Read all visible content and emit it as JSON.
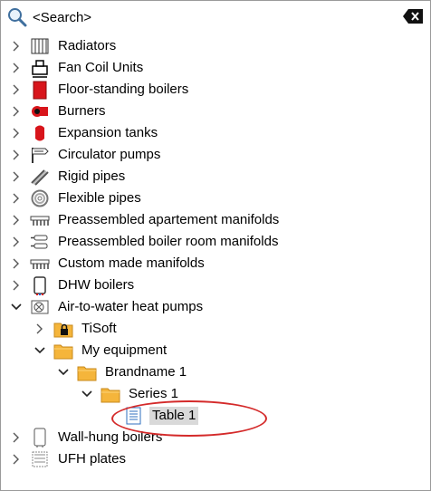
{
  "search": {
    "placeholder": "<Search>",
    "icon": "magnifier-icon",
    "clear_icon": "clear-input-icon"
  },
  "tree": {
    "items": [
      {
        "label": "Radiators",
        "icon": "radiator-icon",
        "expanded": false,
        "level": 0
      },
      {
        "label": "Fan Coil Units",
        "icon": "fan-coil-icon",
        "expanded": false,
        "level": 0
      },
      {
        "label": "Floor-standing boilers",
        "icon": "boiler-icon",
        "expanded": false,
        "level": 0
      },
      {
        "label": "Burners",
        "icon": "burner-icon",
        "expanded": false,
        "level": 0
      },
      {
        "label": "Expansion tanks",
        "icon": "expansion-tank-icon",
        "expanded": false,
        "level": 0
      },
      {
        "label": "Circulator pumps",
        "icon": "pump-icon",
        "expanded": false,
        "level": 0
      },
      {
        "label": "Rigid pipes",
        "icon": "rigid-pipe-icon",
        "expanded": false,
        "level": 0
      },
      {
        "label": "Flexible pipes",
        "icon": "flexible-pipe-icon",
        "expanded": false,
        "level": 0
      },
      {
        "label": "Preassembled apartement manifolds",
        "icon": "manifold-icon",
        "expanded": false,
        "level": 0
      },
      {
        "label": "Preassembled boiler room manifolds",
        "icon": "boiler-room-manifold-icon",
        "expanded": false,
        "level": 0
      },
      {
        "label": "Custom made manifolds",
        "icon": "manifold-icon",
        "expanded": false,
        "level": 0
      },
      {
        "label": "DHW boilers",
        "icon": "dhw-boiler-icon",
        "expanded": false,
        "level": 0
      },
      {
        "label": "Air-to-water heat pumps",
        "icon": "heat-pump-icon",
        "expanded": true,
        "level": 0
      },
      {
        "label": "TiSoft",
        "icon": "locked-folder-icon",
        "expanded": false,
        "level": 1
      },
      {
        "label": "My equipment",
        "icon": "folder-icon",
        "expanded": true,
        "level": 1
      },
      {
        "label": "Brandname 1",
        "icon": "folder-icon",
        "expanded": true,
        "level": 2
      },
      {
        "label": "Series 1",
        "icon": "folder-icon",
        "expanded": true,
        "level": 3
      },
      {
        "label": "Table 1",
        "icon": "table-document-icon",
        "expanded": null,
        "level": 4,
        "selected": true
      },
      {
        "label": "Wall-hung boilers",
        "icon": "wall-boiler-icon",
        "expanded": false,
        "level": 0
      },
      {
        "label": "UFH plates",
        "icon": "ufh-plate-icon",
        "expanded": false,
        "level": 0
      }
    ]
  },
  "colors": {
    "highlight_ring": "#d42a2a",
    "selection": "#d9d9d9",
    "folder": "#f5b53b",
    "boiler_red": "#d8151b"
  }
}
